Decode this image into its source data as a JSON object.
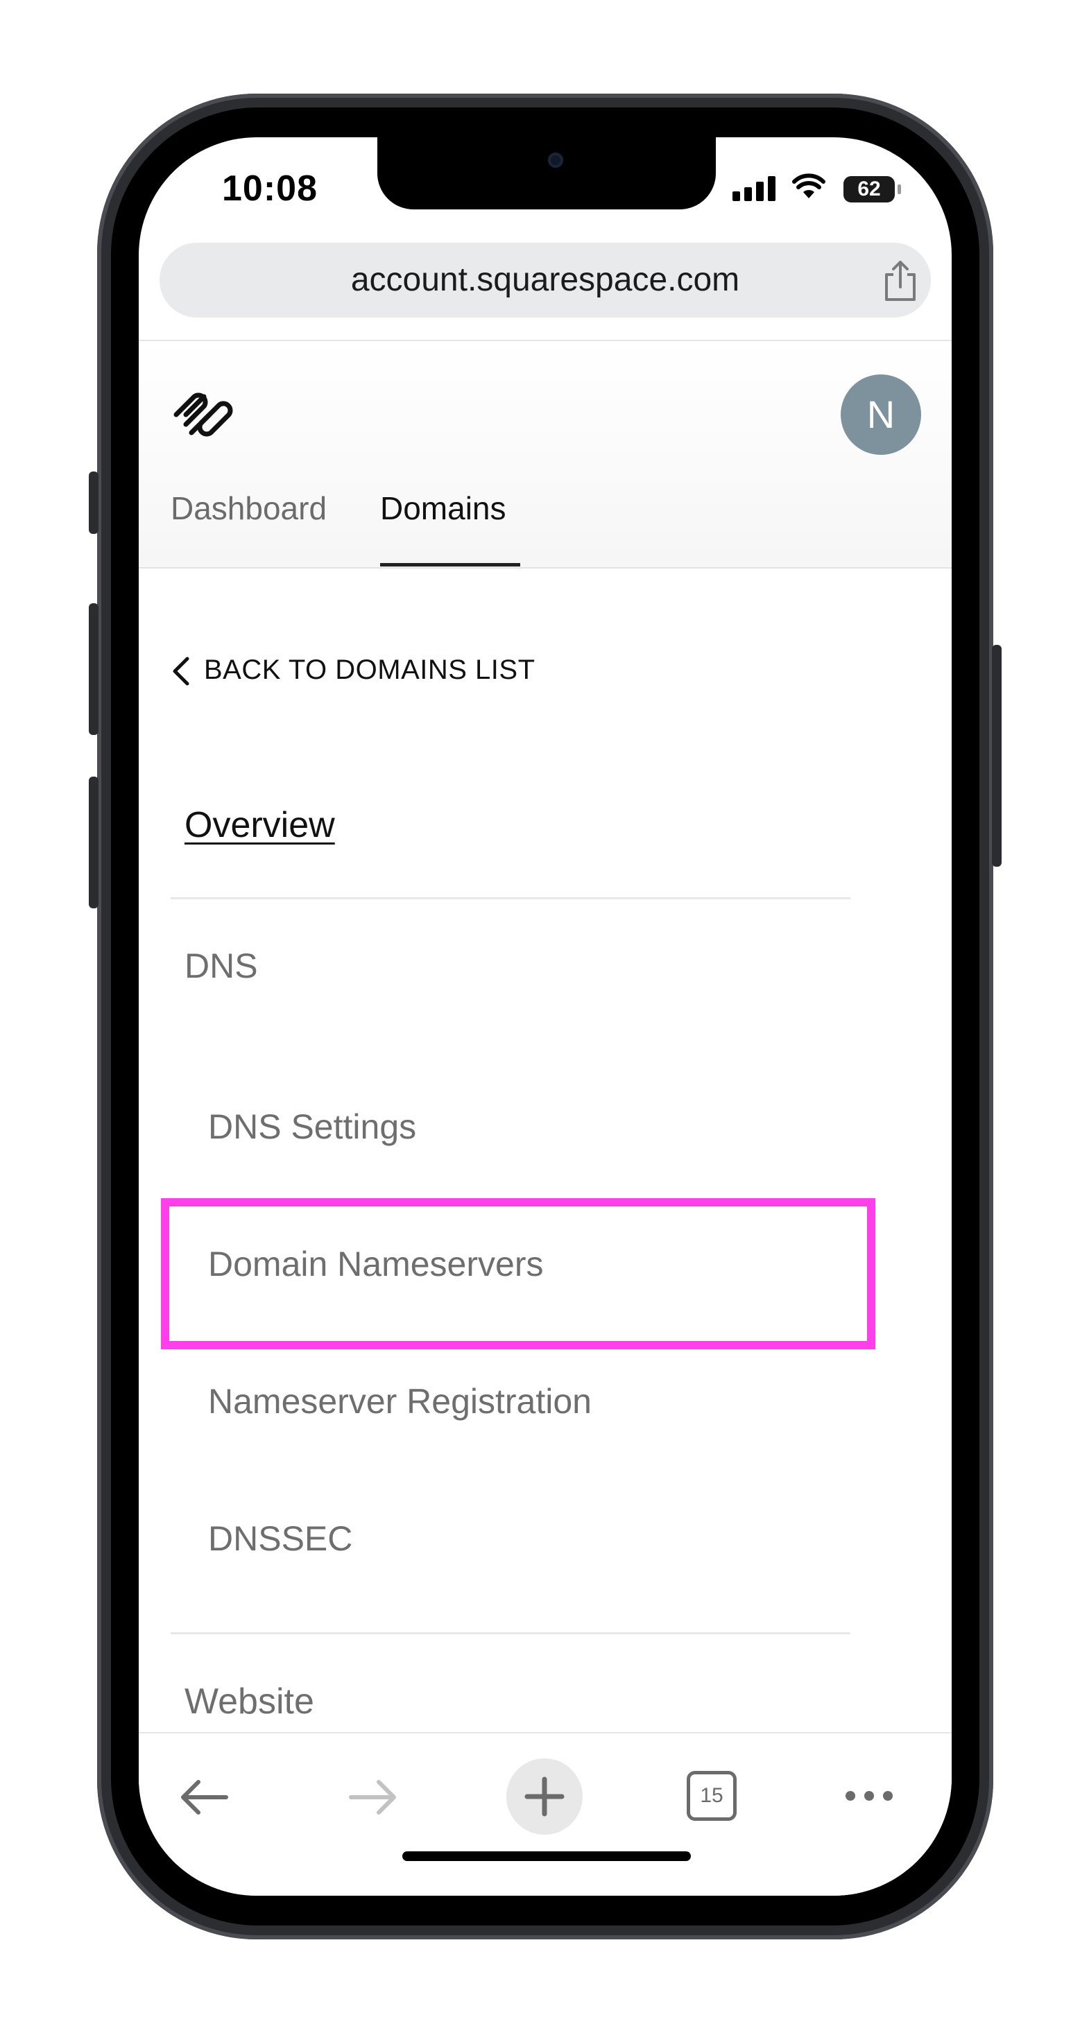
{
  "status_bar": {
    "time": "10:08",
    "battery": "62"
  },
  "browser": {
    "url": "account.squarespace.com",
    "tab_count": "15"
  },
  "header": {
    "avatar_initial": "N",
    "tabs": [
      {
        "label": "Dashboard",
        "active": false
      },
      {
        "label": "Domains",
        "active": true
      }
    ]
  },
  "nav": {
    "back_label": "BACK TO DOMAINS LIST",
    "overview": "Overview",
    "dns_section": "DNS",
    "dns_items": [
      "DNS Settings",
      "Domain Nameservers",
      "Nameserver Registration",
      "DNSSEC"
    ],
    "website_section": "Website"
  },
  "colors": {
    "highlight": "#ff3fe9",
    "avatar": "#7e929d"
  }
}
